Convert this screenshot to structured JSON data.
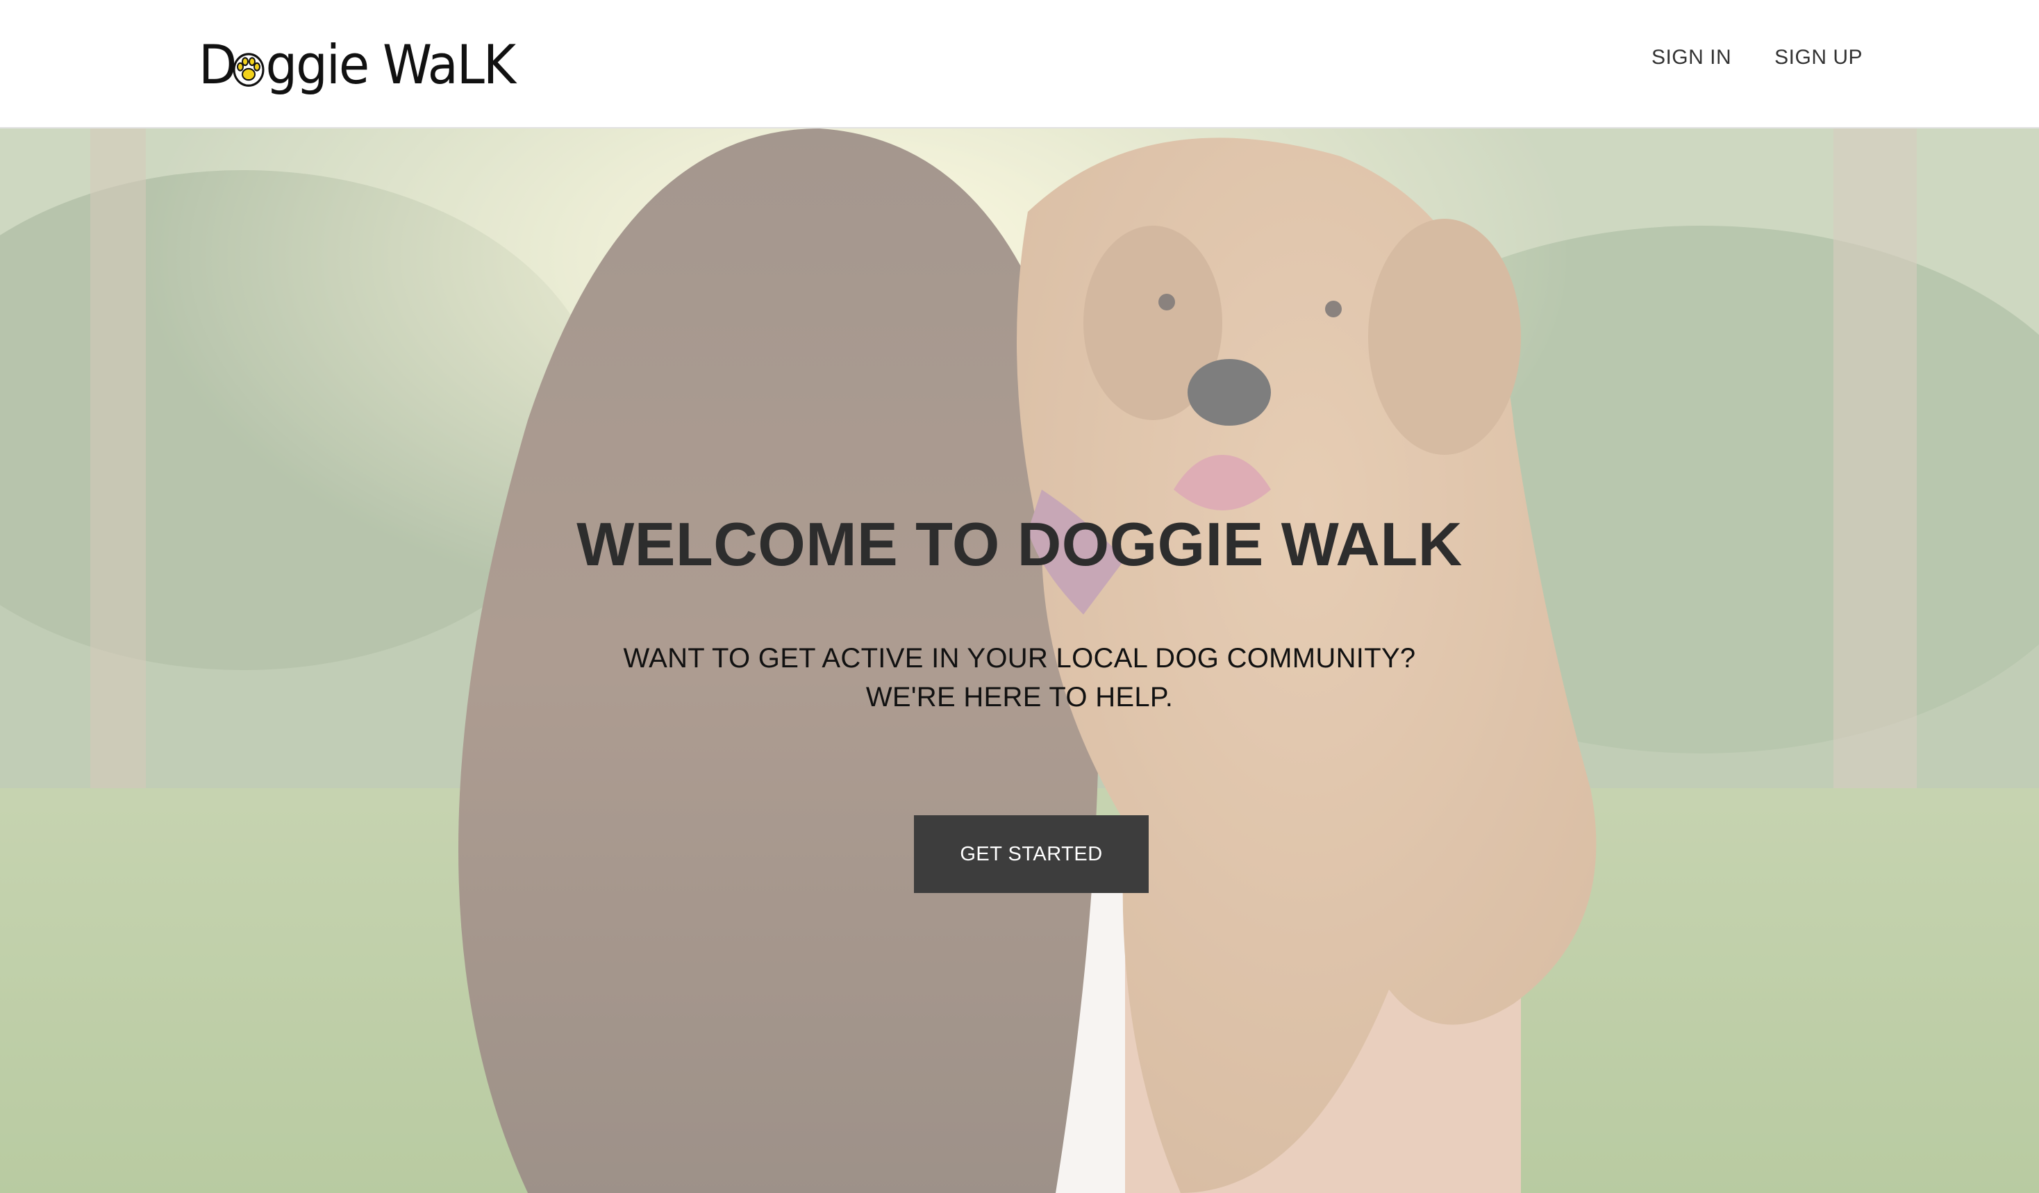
{
  "header": {
    "logo_text": "Doggie Walk",
    "logo_initial": "D",
    "logo_rest": "ggie WaLK",
    "nav": [
      {
        "label": "SIGN IN"
      },
      {
        "label": "SIGN UP"
      }
    ]
  },
  "hero": {
    "title": "WELCOME TO DOGGIE WALK",
    "subtitle_line1": "WANT TO GET ACTIVE IN YOUR LOCAL DOG COMMUNITY?",
    "subtitle_line2": "WE'RE HERE TO HELP.",
    "cta_label": "GET STARTED",
    "background": "photo of a woman with long hair holding a fluffy golden doodle outdoors"
  },
  "colors": {
    "header_bg": "#ffffff",
    "nav_text": "#333333",
    "title_text": "#2d2d2d",
    "cta_bg": "#3d3d3d",
    "cta_text": "#ffffff",
    "paw_accent": "#f2d21b"
  },
  "icons": [
    "paw-icon"
  ]
}
